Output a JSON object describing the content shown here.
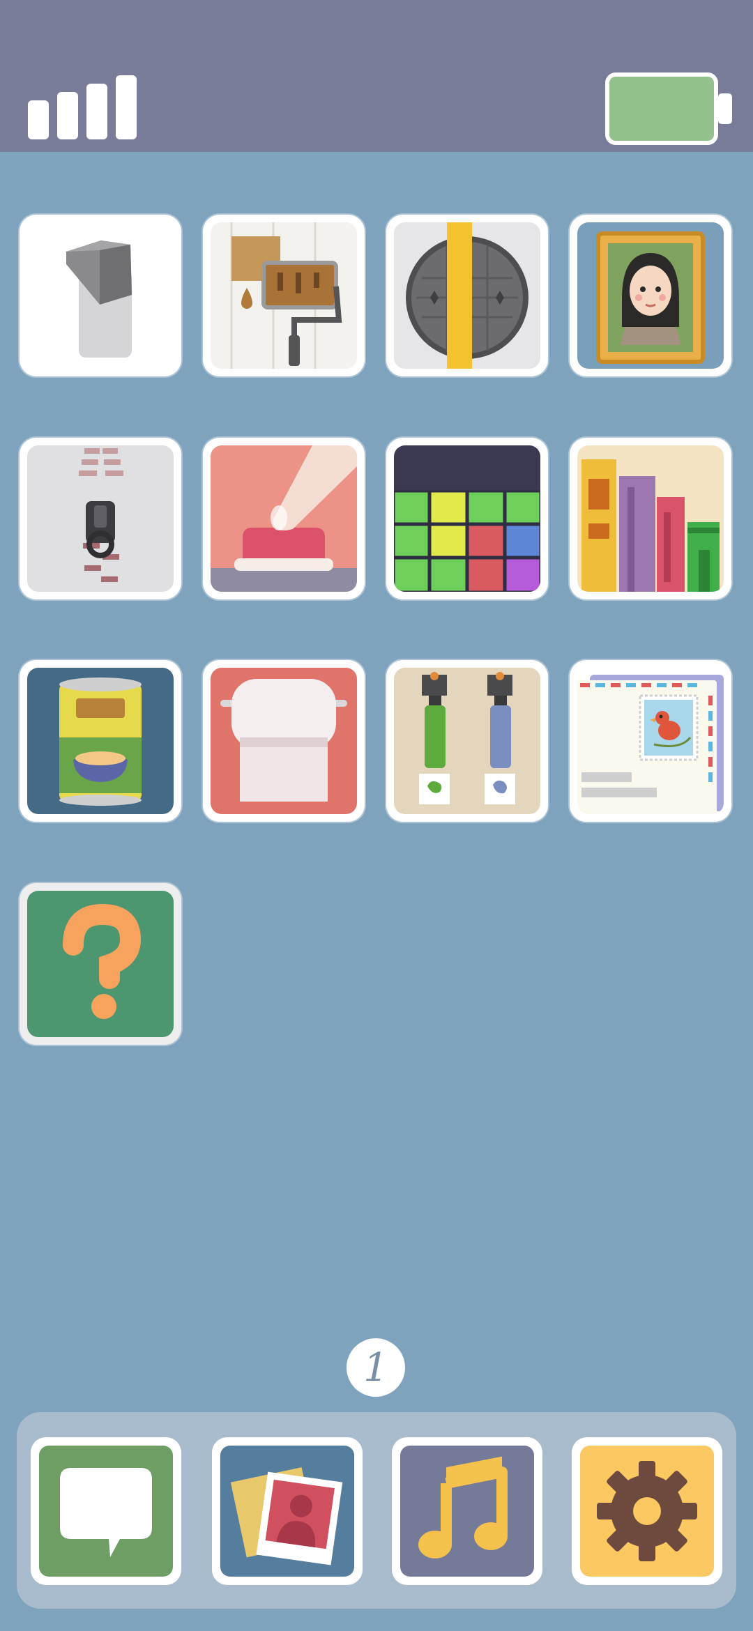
{
  "status_bar": {
    "signal_icon": "signal-bars-icon",
    "battery_icon": "battery-icon",
    "colors": {
      "bar": "#797c98",
      "battery_fill": "#93c28d"
    }
  },
  "home_grid": {
    "apps": [
      {
        "icon": "light-switch-icon"
      },
      {
        "icon": "paint-roller-icon"
      },
      {
        "icon": "manhole-cover-icon"
      },
      {
        "icon": "framed-portrait-icon"
      },
      {
        "icon": "zipper-icon"
      },
      {
        "icon": "push-button-icon"
      },
      {
        "icon": "block-puzzle-icon"
      },
      {
        "icon": "bookshelf-icon"
      },
      {
        "icon": "soup-can-icon"
      },
      {
        "icon": "toilet-paper-icon"
      },
      {
        "icon": "paint-tubes-icon"
      },
      {
        "icon": "airmail-envelope-icon"
      },
      {
        "icon": "question-mark-icon"
      }
    ]
  },
  "page_indicator": {
    "label": "1"
  },
  "dock": {
    "apps": [
      {
        "icon": "message-bubble-icon"
      },
      {
        "icon": "photos-icon"
      },
      {
        "icon": "music-note-icon"
      },
      {
        "icon": "settings-gear-icon"
      }
    ]
  },
  "colors": {
    "background": "#7fa3bd",
    "dock": "#a9bccd",
    "tile_border": "#ffffff"
  }
}
